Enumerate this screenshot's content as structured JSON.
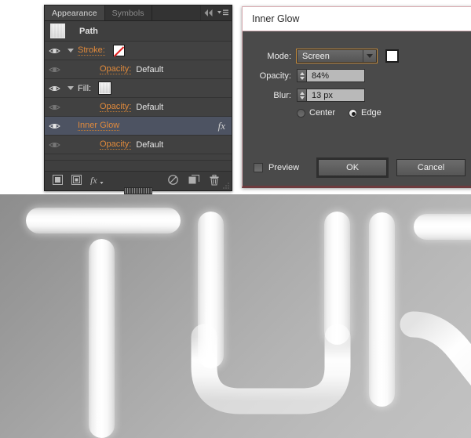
{
  "panel": {
    "tabs": [
      {
        "label": "Appearance",
        "active": true
      },
      {
        "label": "Symbols",
        "active": false
      }
    ],
    "icons": {
      "collapse": "double-chevron-left-icon",
      "menu": "panel-menu-icon"
    },
    "object_row": {
      "thumbnail": "path-thumbnail",
      "title": "Path"
    },
    "rows": [
      {
        "label": "Stroke:",
        "type": "link",
        "visible": true,
        "has_disclosure": true,
        "swatch": "none-swatch"
      },
      {
        "label": "Opacity:",
        "value": "Default",
        "type": "sub",
        "visible": false
      },
      {
        "label": "Fill:",
        "type": "plain",
        "visible": true,
        "has_disclosure": true,
        "swatch": "fill-swatch"
      },
      {
        "label": "Opacity:",
        "value": "Default",
        "type": "sub",
        "visible": false
      },
      {
        "label": "Inner Glow",
        "type": "effect",
        "visible": true,
        "selected": true,
        "fx": "fx"
      },
      {
        "label": "Opacity:",
        "value": "Default",
        "type": "sub",
        "visible": false
      }
    ],
    "footer_icons": [
      "add-new-stroke-icon",
      "add-new-fill-icon",
      "add-new-effect-icon",
      "clear-appearance-icon",
      "duplicate-selected-item-icon",
      "delete-selected-item-icon"
    ]
  },
  "dialog": {
    "title": "Inner Glow",
    "mode": {
      "label": "Mode:",
      "value": "Screen",
      "color_swatch": "#ffffff"
    },
    "opacity": {
      "label": "Opacity:",
      "value": "84%"
    },
    "blur": {
      "label": "Blur:",
      "value": "13 px"
    },
    "origin": {
      "options": [
        {
          "label": "Center",
          "selected": false
        },
        {
          "label": "Edge",
          "selected": true
        }
      ]
    },
    "preview": {
      "label": "Preview",
      "checked": false
    },
    "buttons": {
      "ok": "OK",
      "cancel": "Cancel"
    }
  },
  "artwork": {
    "description": "Glowing white rounded strokes forming the letters T U I K on a gray gradient background",
    "background_from": "#8d8d8d",
    "background_to": "#c2c2c2",
    "stroke_color": "#ffffff"
  }
}
